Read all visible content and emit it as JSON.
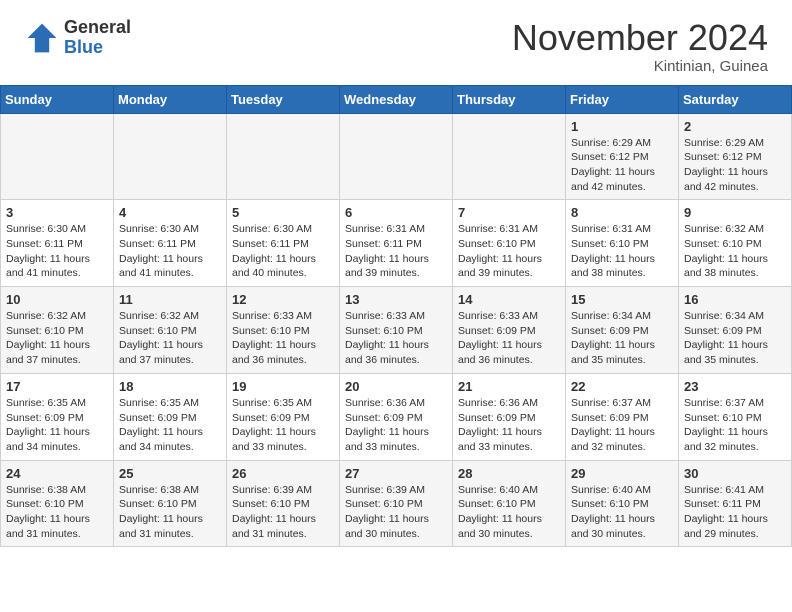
{
  "header": {
    "logo_general": "General",
    "logo_blue": "Blue",
    "month_title": "November 2024",
    "location": "Kintinian, Guinea"
  },
  "weekdays": [
    "Sunday",
    "Monday",
    "Tuesday",
    "Wednesday",
    "Thursday",
    "Friday",
    "Saturday"
  ],
  "weeks": [
    [
      {
        "day": "",
        "info": ""
      },
      {
        "day": "",
        "info": ""
      },
      {
        "day": "",
        "info": ""
      },
      {
        "day": "",
        "info": ""
      },
      {
        "day": "",
        "info": ""
      },
      {
        "day": "1",
        "info": "Sunrise: 6:29 AM\nSunset: 6:12 PM\nDaylight: 11 hours\nand 42 minutes."
      },
      {
        "day": "2",
        "info": "Sunrise: 6:29 AM\nSunset: 6:12 PM\nDaylight: 11 hours\nand 42 minutes."
      }
    ],
    [
      {
        "day": "3",
        "info": "Sunrise: 6:30 AM\nSunset: 6:11 PM\nDaylight: 11 hours\nand 41 minutes."
      },
      {
        "day": "4",
        "info": "Sunrise: 6:30 AM\nSunset: 6:11 PM\nDaylight: 11 hours\nand 41 minutes."
      },
      {
        "day": "5",
        "info": "Sunrise: 6:30 AM\nSunset: 6:11 PM\nDaylight: 11 hours\nand 40 minutes."
      },
      {
        "day": "6",
        "info": "Sunrise: 6:31 AM\nSunset: 6:11 PM\nDaylight: 11 hours\nand 39 minutes."
      },
      {
        "day": "7",
        "info": "Sunrise: 6:31 AM\nSunset: 6:10 PM\nDaylight: 11 hours\nand 39 minutes."
      },
      {
        "day": "8",
        "info": "Sunrise: 6:31 AM\nSunset: 6:10 PM\nDaylight: 11 hours\nand 38 minutes."
      },
      {
        "day": "9",
        "info": "Sunrise: 6:32 AM\nSunset: 6:10 PM\nDaylight: 11 hours\nand 38 minutes."
      }
    ],
    [
      {
        "day": "10",
        "info": "Sunrise: 6:32 AM\nSunset: 6:10 PM\nDaylight: 11 hours\nand 37 minutes."
      },
      {
        "day": "11",
        "info": "Sunrise: 6:32 AM\nSunset: 6:10 PM\nDaylight: 11 hours\nand 37 minutes."
      },
      {
        "day": "12",
        "info": "Sunrise: 6:33 AM\nSunset: 6:10 PM\nDaylight: 11 hours\nand 36 minutes."
      },
      {
        "day": "13",
        "info": "Sunrise: 6:33 AM\nSunset: 6:10 PM\nDaylight: 11 hours\nand 36 minutes."
      },
      {
        "day": "14",
        "info": "Sunrise: 6:33 AM\nSunset: 6:09 PM\nDaylight: 11 hours\nand 36 minutes."
      },
      {
        "day": "15",
        "info": "Sunrise: 6:34 AM\nSunset: 6:09 PM\nDaylight: 11 hours\nand 35 minutes."
      },
      {
        "day": "16",
        "info": "Sunrise: 6:34 AM\nSunset: 6:09 PM\nDaylight: 11 hours\nand 35 minutes."
      }
    ],
    [
      {
        "day": "17",
        "info": "Sunrise: 6:35 AM\nSunset: 6:09 PM\nDaylight: 11 hours\nand 34 minutes."
      },
      {
        "day": "18",
        "info": "Sunrise: 6:35 AM\nSunset: 6:09 PM\nDaylight: 11 hours\nand 34 minutes."
      },
      {
        "day": "19",
        "info": "Sunrise: 6:35 AM\nSunset: 6:09 PM\nDaylight: 11 hours\nand 33 minutes."
      },
      {
        "day": "20",
        "info": "Sunrise: 6:36 AM\nSunset: 6:09 PM\nDaylight: 11 hours\nand 33 minutes."
      },
      {
        "day": "21",
        "info": "Sunrise: 6:36 AM\nSunset: 6:09 PM\nDaylight: 11 hours\nand 33 minutes."
      },
      {
        "day": "22",
        "info": "Sunrise: 6:37 AM\nSunset: 6:09 PM\nDaylight: 11 hours\nand 32 minutes."
      },
      {
        "day": "23",
        "info": "Sunrise: 6:37 AM\nSunset: 6:10 PM\nDaylight: 11 hours\nand 32 minutes."
      }
    ],
    [
      {
        "day": "24",
        "info": "Sunrise: 6:38 AM\nSunset: 6:10 PM\nDaylight: 11 hours\nand 31 minutes."
      },
      {
        "day": "25",
        "info": "Sunrise: 6:38 AM\nSunset: 6:10 PM\nDaylight: 11 hours\nand 31 minutes."
      },
      {
        "day": "26",
        "info": "Sunrise: 6:39 AM\nSunset: 6:10 PM\nDaylight: 11 hours\nand 31 minutes."
      },
      {
        "day": "27",
        "info": "Sunrise: 6:39 AM\nSunset: 6:10 PM\nDaylight: 11 hours\nand 30 minutes."
      },
      {
        "day": "28",
        "info": "Sunrise: 6:40 AM\nSunset: 6:10 PM\nDaylight: 11 hours\nand 30 minutes."
      },
      {
        "day": "29",
        "info": "Sunrise: 6:40 AM\nSunset: 6:10 PM\nDaylight: 11 hours\nand 30 minutes."
      },
      {
        "day": "30",
        "info": "Sunrise: 6:41 AM\nSunset: 6:11 PM\nDaylight: 11 hours\nand 29 minutes."
      }
    ]
  ]
}
